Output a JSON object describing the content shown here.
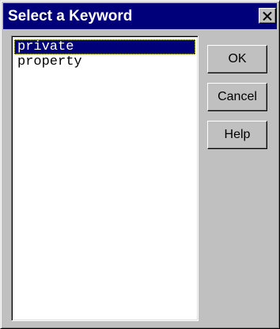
{
  "window": {
    "title": "Select a Keyword",
    "close_icon": "close-icon"
  },
  "keywords": {
    "items": [
      "private",
      "property"
    ],
    "selected": "private"
  },
  "buttons": {
    "ok": "OK",
    "cancel": "Cancel",
    "help": "Help"
  },
  "colors": {
    "titlebar": "#00007b",
    "selection": "#00007b",
    "face": "#c0c0c0"
  }
}
